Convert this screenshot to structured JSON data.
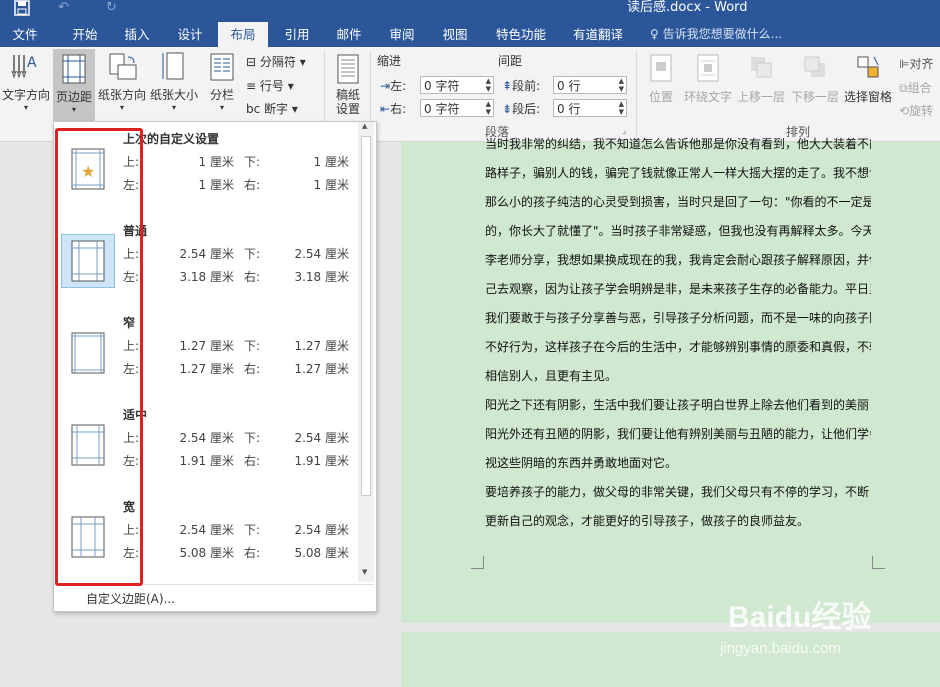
{
  "window": {
    "title": "读后感.docx - Word"
  },
  "tabs": [
    {
      "label": "文件"
    },
    {
      "label": "开始"
    },
    {
      "label": "插入"
    },
    {
      "label": "设计"
    },
    {
      "label": "布局"
    },
    {
      "label": "引用"
    },
    {
      "label": "邮件"
    },
    {
      "label": "审阅"
    },
    {
      "label": "视图"
    },
    {
      "label": "特色功能"
    },
    {
      "label": "有道翻译"
    }
  ],
  "tell_me": "告诉我您想要做什么...",
  "ribbon": {
    "text_direction": "文字方向",
    "margins": "页边距",
    "orientation": "纸张方向",
    "size": "纸张大小",
    "columns": "分栏",
    "breaks": "分隔符",
    "line_numbers": "行号",
    "hyphenation": "断字",
    "draft_paper": "稿纸\n设置",
    "indent_label": "缩进",
    "spacing_label": "间距",
    "indent_left_label": "左:",
    "indent_left_value": "0 字符",
    "indent_right_label": "右:",
    "indent_right_value": "0 字符",
    "space_before_label": "段前:",
    "space_before_value": "0 行",
    "space_after_label": "段后:",
    "space_after_value": "0 行",
    "paragraph_group": "段落",
    "position": "位置",
    "wrap_text": "环绕文字",
    "bring_forward": "上移一层",
    "send_backward": "下移一层",
    "selection_pane": "选择窗格",
    "align": "对齐",
    "group": "组合",
    "rotate": "旋转",
    "arrange_group": "排列"
  },
  "margins_menu": {
    "options": [
      {
        "name": "上次的自定义设置",
        "top_label": "上:",
        "top": "1 厘米",
        "bottom_label": "下:",
        "bottom": "1 厘米",
        "left_label": "左:",
        "left": "1 厘米",
        "right_label": "右:",
        "right": "1 厘米"
      },
      {
        "name": "普通",
        "top_label": "上:",
        "top": "2.54 厘米",
        "bottom_label": "下:",
        "bottom": "2.54 厘米",
        "left_label": "左:",
        "left": "3.18 厘米",
        "right_label": "右:",
        "right": "3.18 厘米"
      },
      {
        "name": "窄",
        "top_label": "上:",
        "top": "1.27 厘米",
        "bottom_label": "下:",
        "bottom": "1.27 厘米",
        "left_label": "左:",
        "left": "1.27 厘米",
        "right_label": "右:",
        "right": "1.27 厘米"
      },
      {
        "name": "适中",
        "top_label": "上:",
        "top": "2.54 厘米",
        "bottom_label": "下:",
        "bottom": "2.54 厘米",
        "left_label": "左:",
        "left": "1.91 厘米",
        "right_label": "右:",
        "right": "1.91 厘米"
      },
      {
        "name": "宽",
        "top_label": "上:",
        "top": "2.54 厘米",
        "bottom_label": "下:",
        "bottom": "2.54 厘米",
        "left_label": "左:",
        "left": "5.08 厘米",
        "right_label": "右:",
        "right": "5.08 厘米"
      }
    ],
    "custom": "自定义边距(A)..."
  },
  "document": {
    "lines": [
      "当时我非常的纠结，我不知道怎么告诉他那是你没有看到，他大大装着不能走",
      "路样子，骗别人的钱，骗完了钱就像正常人一样大摇大摆的走了。我不想让他",
      "那么小的孩子纯洁的心灵受到损害，当时只是回了一句：\"你看的不一定是真",
      "的，你长大了就懂了\"。当时孩子非常疑惑，但我也没有再解释太多。今天听了",
      "李老师分享，我想如果换成现在的我，我肯定会耐心跟孩子解释原因，并他自",
      "己去观察，因为让孩子学会明辨是非，是未来孩子生存的必备能力。平日里，",
      "我们要敢于与孩子分享善与恶，引导孩子分析问题，而不是一味的向孩子隐瞒",
      "不好行为，这样孩子在今后的生活中，才能够辨别事情的原委和真假，不轻言",
      "相信别人，且更有主见。",
      "      阳光之下还有阴影，生活中我们要让孩子明白世界上除去他们看到的美丽",
      "阳光外还有丑陋的阴影，我们要让他有辨别美丽与丑陋的能力，让他们学会正",
      "视这些阴暗的东西并勇敢地面对它。",
      "      要培养孩子的能力，做父母的非常关键，我们父母只有不停的学习，不断",
      "更新自己的观念，才能更好的引导孩子，做孩子的良师益友。"
    ]
  },
  "watermark": {
    "brand": "Baidu经验",
    "url": "jingyan.baidu.com"
  },
  "colors": {
    "accent": "#2b579a",
    "page": "#cfe8cf",
    "highlight": "#e02020"
  }
}
